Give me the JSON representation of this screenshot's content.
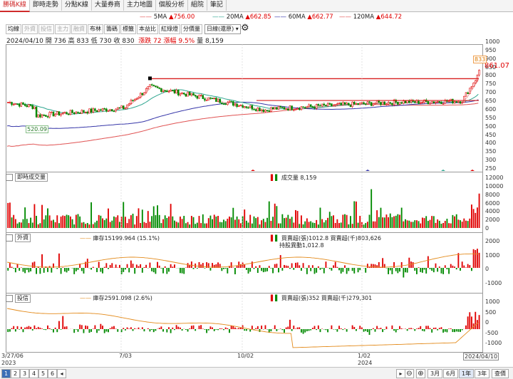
{
  "tabs": [
    "勝碼K線",
    "即時走勢",
    "分點K線",
    "大量券商",
    "主力地圖",
    "個股分析",
    "組院",
    "筆記"
  ],
  "ma_legend": [
    {
      "label": "5MA",
      "value": "▲756.00",
      "color": "#e05252"
    },
    {
      "label": "20MA",
      "value": "▲662.85",
      "color": "#2ea58f"
    },
    {
      "label": "60MA",
      "value": "▲662.77",
      "color": "#3535a8"
    },
    {
      "label": "120MA",
      "value": "▲644.72",
      "color": "#e05252"
    }
  ],
  "toolbar": {
    "buttons": [
      "均線",
      "外資",
      "投信",
      "主力",
      "融資",
      "布林",
      "籌碼",
      "標籤",
      "本益比",
      "紅綠燈",
      "分價量"
    ],
    "dim_buttons": [
      1,
      2,
      3,
      4
    ],
    "period": "日線(還原)"
  },
  "ohlc": {
    "date": "2024/04/10",
    "open": "開 736",
    "high": "高 833",
    "low": "低 730",
    "close": "收 830",
    "change": "漲跌 72",
    "pct": "漲幅 9.5%",
    "volume": "量 8,159"
  },
  "price_panel": {
    "current": "861.07",
    "high_label": "833",
    "low_label": "520.09",
    "yaxis": [
      "1000",
      "950",
      "900",
      "850",
      "800",
      "750",
      "700",
      "650",
      "600",
      "550",
      "500",
      "450",
      "400",
      "350",
      "300",
      "250"
    ]
  },
  "volume_panel": {
    "title": "即時成交量",
    "legend": "成交量 8,159",
    "yaxis": [
      "12000",
      "10000",
      "8000",
      "6000",
      "4000",
      "2000",
      "0"
    ]
  },
  "foreign_panel": {
    "title": "外資",
    "inventory": "庫存15199.964 (15.1%)",
    "legend": "買賣超(張)1012.8 買賣超(千)803,626",
    "legend2": "持股異動1,012.8",
    "yaxis": [
      "2000",
      "1000",
      "0",
      "-1000"
    ]
  },
  "trust_panel": {
    "title": "投信",
    "inventory": "庫存2591.098 (2.6%)",
    "legend": "買賣超(張)352 買賣超(千)279,301",
    "yaxis": [
      "1000",
      "500",
      "0",
      "-500",
      "-1000"
    ]
  },
  "xaxis": {
    "labels": [
      "3/27/06",
      "7/03",
      "10/02",
      "1/02",
      "2024/04/10"
    ],
    "years": [
      "2023",
      "2024"
    ]
  },
  "bottom": {
    "pages": [
      "1",
      "2",
      "3",
      "4",
      "5",
      "6"
    ],
    "ranges": [
      "3月",
      "6月",
      "1年",
      "3年",
      "查價"
    ],
    "zoom_in": "⊖",
    "zoom_out": "⊕"
  },
  "colors": {
    "up": "#e00000",
    "down": "#008a00",
    "ma5": "#e05252",
    "ma20": "#2ea58f",
    "ma60": "#3535a8",
    "ma120": "#e05252",
    "line": "#e38a1a"
  }
}
